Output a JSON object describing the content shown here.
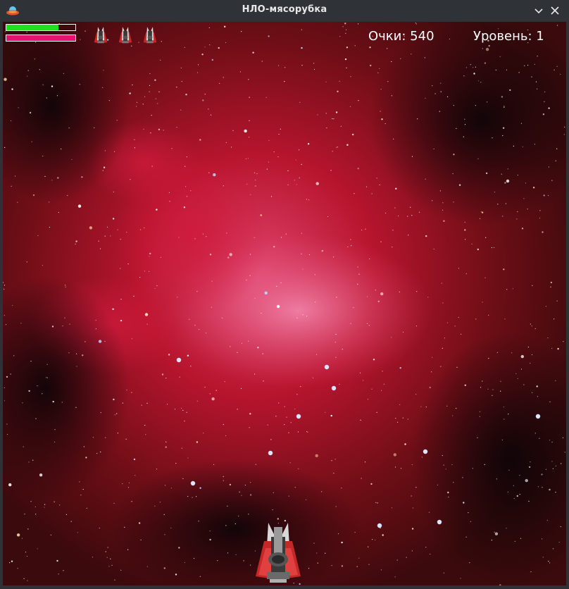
{
  "window": {
    "title": "НЛО-мясорубка",
    "icon": "ufo-icon"
  },
  "titlebar_buttons": {
    "minimize_icon": "chevron-down-icon",
    "close_icon": "close-icon"
  },
  "hud": {
    "health": {
      "fraction": 0.75,
      "color": "#22e01e"
    },
    "energy": {
      "fraction": 1.0,
      "color": "#e5136f"
    },
    "lives": {
      "count": 3,
      "icon": "player-ship-icon"
    },
    "score_text": "Очки: 540",
    "level_text": "Уровень: 1"
  },
  "player": {
    "icon": "player-ship-icon"
  },
  "colors": {
    "nebula": "#c0123a",
    "space": "#1a0608",
    "hud_text": "#ffffff"
  }
}
